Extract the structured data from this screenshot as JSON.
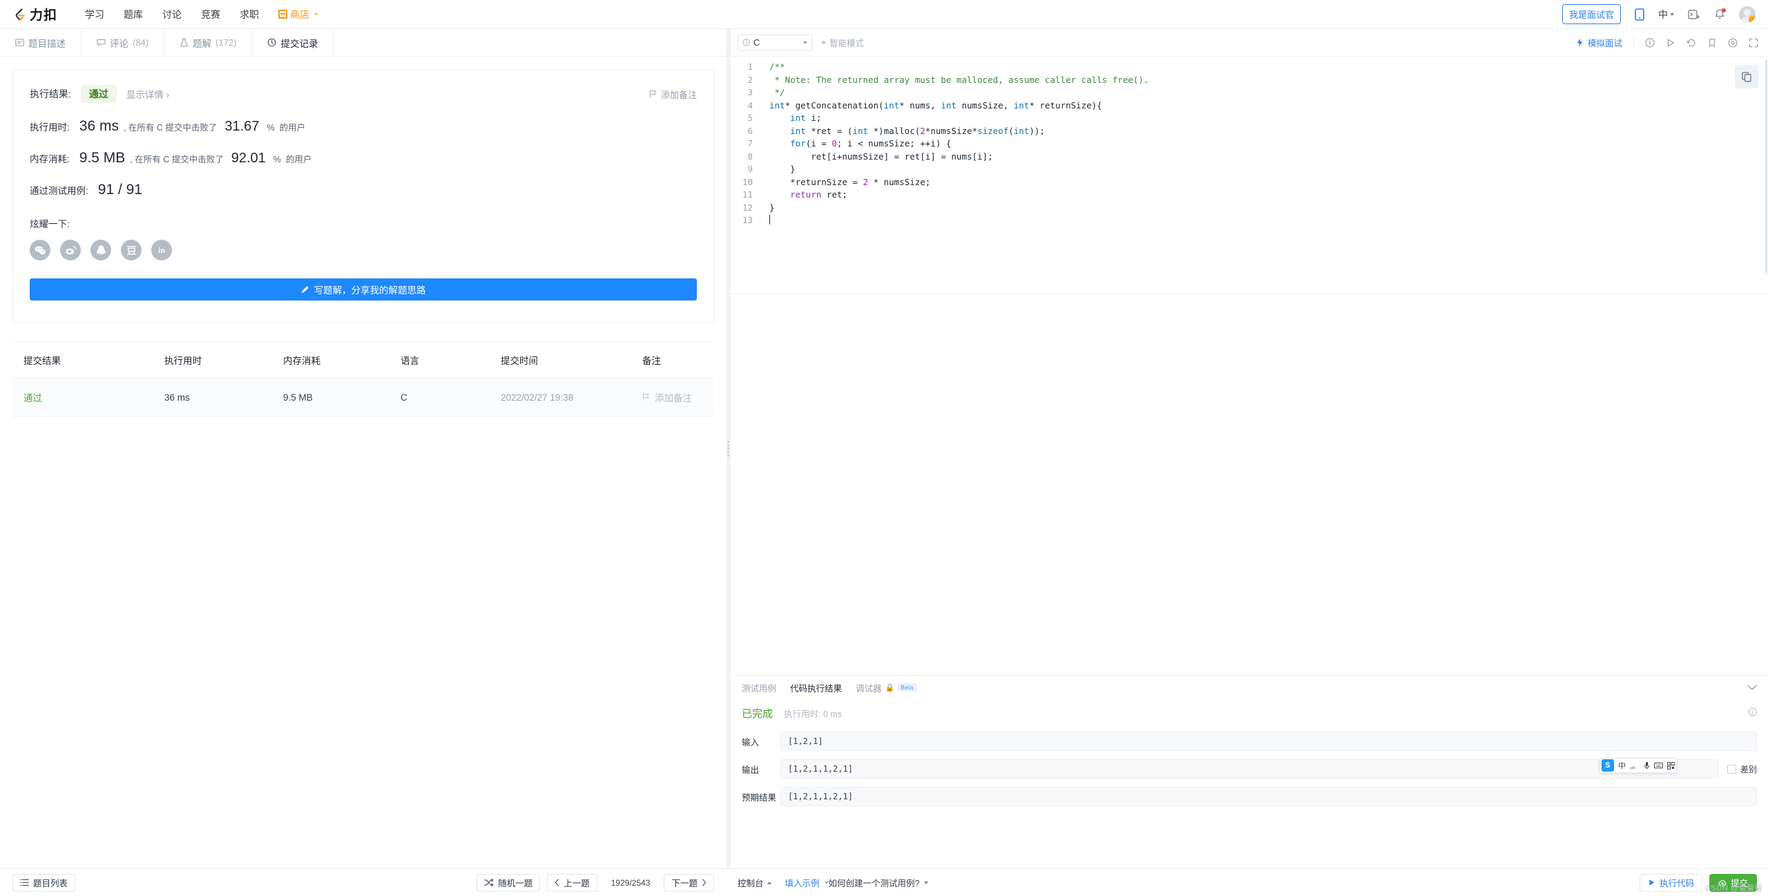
{
  "topnav": {
    "brand": "力扣",
    "links": [
      {
        "label": "学习",
        "name": "nav-study"
      },
      {
        "label": "题库",
        "name": "nav-problems"
      },
      {
        "label": "讨论",
        "name": "nav-discuss"
      },
      {
        "label": "竞赛",
        "name": "nav-contest"
      },
      {
        "label": "求职",
        "name": "nav-jobs"
      }
    ],
    "shop": "商店",
    "interview_button": "我是面试官",
    "language": "中"
  },
  "left_tabs": [
    {
      "label": "题目描述",
      "count": "",
      "icon": "description-icon",
      "active": false
    },
    {
      "label": "评论",
      "count": "(84)",
      "icon": "comment-icon",
      "active": false
    },
    {
      "label": "题解",
      "count": "(172)",
      "icon": "solution-flask-icon",
      "active": false
    },
    {
      "label": "提交记录",
      "count": "",
      "icon": "clock-icon",
      "active": true
    }
  ],
  "result": {
    "result_label": "执行结果:",
    "status": "通过",
    "show_detail": "显示详情",
    "add_note": "添加备注",
    "runtime_label": "执行用时:",
    "runtime_value": "36 ms",
    "runtime_mid": ", 在所有 C 提交中击败了",
    "runtime_pct": "31.67",
    "runtime_pct_sym": "%",
    "runtime_tail": "的用户",
    "memory_label": "内存消耗:",
    "memory_value": "9.5 MB",
    "memory_mid": ", 在所有 C 提交中击败了",
    "memory_pct": "92.01",
    "memory_pct_sym": "%",
    "memory_tail": "的用户",
    "testcase_label": "通过测试用例:",
    "testcase_value": "91 / 91",
    "brag_label": "炫耀一下:",
    "share_icons": [
      "wechat-icon",
      "weibo-icon",
      "qq-icon",
      "douban-icon",
      "linkedin-icon"
    ],
    "write_solution_button": "写题解，分享我的解题思路"
  },
  "submissions_table": {
    "headers": [
      "提交结果",
      "执行用时",
      "内存消耗",
      "语言",
      "提交时间",
      "备注"
    ],
    "rows": [
      {
        "status": "通过",
        "runtime": "36 ms",
        "memory": "9.5 MB",
        "language": "C",
        "time": "2022/02/27 19:38",
        "note": "添加备注"
      }
    ]
  },
  "editor": {
    "language": "C",
    "smart_mode": "智能模式",
    "mock_interview": "模拟面试",
    "code_lines": [
      {
        "n": "1",
        "tokens": [
          {
            "t": "/**",
            "c": "cmt"
          }
        ]
      },
      {
        "n": "2",
        "tokens": [
          {
            "t": " * Note: The returned array must be malloced, assume caller calls free().",
            "c": "cmt"
          }
        ]
      },
      {
        "n": "3",
        "tokens": [
          {
            "t": " */",
            "c": "cmt"
          }
        ]
      },
      {
        "n": "4",
        "tokens": [
          {
            "t": "int",
            "c": "type"
          },
          {
            "t": "* getConcatenation(",
            "c": "pl"
          },
          {
            "t": "int",
            "c": "type"
          },
          {
            "t": "* nums, ",
            "c": "pl"
          },
          {
            "t": "int",
            "c": "type"
          },
          {
            "t": " numsSize, ",
            "c": "pl"
          },
          {
            "t": "int",
            "c": "type"
          },
          {
            "t": "* returnSize){",
            "c": "pl"
          }
        ]
      },
      {
        "n": "5",
        "tokens": [
          {
            "t": "    ",
            "c": "pl"
          },
          {
            "t": "int",
            "c": "type"
          },
          {
            "t": " i;",
            "c": "pl"
          }
        ]
      },
      {
        "n": "6",
        "tokens": [
          {
            "t": "    ",
            "c": "pl"
          },
          {
            "t": "int",
            "c": "type"
          },
          {
            "t": " *ret = (",
            "c": "pl"
          },
          {
            "t": "int",
            "c": "type"
          },
          {
            "t": " *)malloc(",
            "c": "pl"
          },
          {
            "t": "2",
            "c": "num"
          },
          {
            "t": "*numsSize*",
            "c": "pl"
          },
          {
            "t": "sizeof",
            "c": "kw"
          },
          {
            "t": "(",
            "c": "pl"
          },
          {
            "t": "int",
            "c": "type"
          },
          {
            "t": "));",
            "c": "pl"
          }
        ]
      },
      {
        "n": "7",
        "tokens": [
          {
            "t": "    ",
            "c": "pl"
          },
          {
            "t": "for",
            "c": "kw"
          },
          {
            "t": "(i = ",
            "c": "pl"
          },
          {
            "t": "0",
            "c": "num"
          },
          {
            "t": "; i < numsSize; ++i) {",
            "c": "pl"
          }
        ]
      },
      {
        "n": "8",
        "tokens": [
          {
            "t": "        ret[i+numsSize] = ret[i] = nums[i];",
            "c": "pl"
          }
        ]
      },
      {
        "n": "9",
        "tokens": [
          {
            "t": "    }",
            "c": "pl"
          }
        ]
      },
      {
        "n": "10",
        "tokens": [
          {
            "t": "    *returnSize = ",
            "c": "pl"
          },
          {
            "t": "2",
            "c": "num"
          },
          {
            "t": " * numsSize;",
            "c": "pl"
          }
        ]
      },
      {
        "n": "11",
        "tokens": [
          {
            "t": "    ",
            "c": "pl"
          },
          {
            "t": "return",
            "c": "ret"
          },
          {
            "t": " ret;",
            "c": "pl"
          }
        ]
      },
      {
        "n": "12",
        "tokens": [
          {
            "t": "}",
            "c": "pl"
          }
        ]
      },
      {
        "n": "13",
        "tokens": []
      }
    ]
  },
  "console": {
    "tabs": [
      {
        "label": "测试用例",
        "active": false,
        "beta": false
      },
      {
        "label": "代码执行结果",
        "active": true,
        "beta": false
      },
      {
        "label": "调试器",
        "active": false,
        "beta": true,
        "beta_label": "Beta"
      }
    ],
    "status": "已完成",
    "status_time": "执行用时: 0 ms",
    "input_label": "输入",
    "input_value": "[1,2,1]",
    "output_label": "输出",
    "output_value": "[1,2,1,1,2,1]",
    "expected_label": "预期结果",
    "expected_value": "[1,2,1,1,2,1]",
    "diff_label": "差别",
    "ime": {
      "logo": "S",
      "mode": "中",
      "items": [
        "punct-icon",
        "mic-icon",
        "keyboard-icon",
        "qr-icon"
      ]
    }
  },
  "bottombar": {
    "problem_list": "题目列表",
    "random": "随机一题",
    "prev": "上一题",
    "page": "1929/2543",
    "next": "下一题",
    "console_toggle": "控制台",
    "fill_sample": "填入示例",
    "how_to": "如何创建一个测试用例?",
    "run": "执行代码",
    "submit": "提交"
  },
  "watermark": "CSDN @菊菊菊",
  "colors": {
    "accent_blue": "#1e88ff",
    "pass_green": "#52a934",
    "brand_orange": "#ffa116",
    "submit_green": "#4caf3e"
  }
}
